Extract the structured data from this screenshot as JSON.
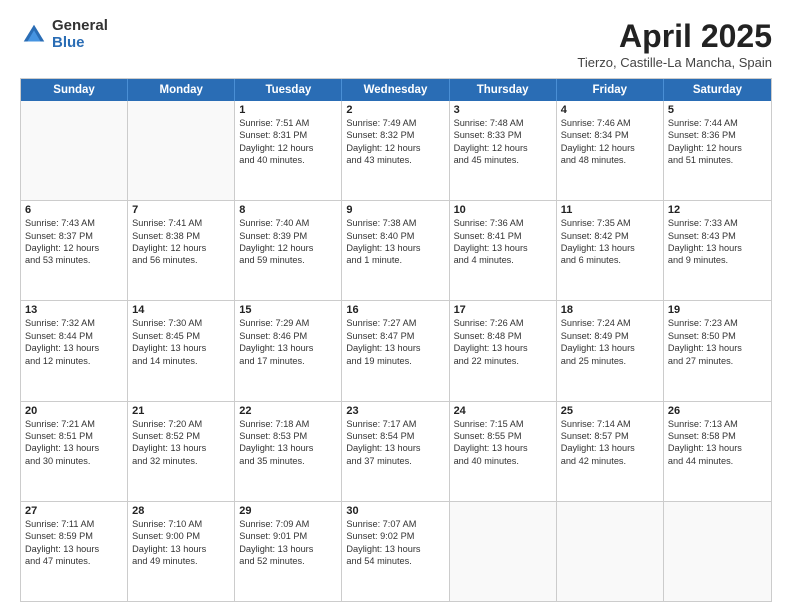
{
  "logo": {
    "general": "General",
    "blue": "Blue"
  },
  "title": {
    "month": "April 2025",
    "location": "Tierzo, Castille-La Mancha, Spain"
  },
  "header_days": [
    "Sunday",
    "Monday",
    "Tuesday",
    "Wednesday",
    "Thursday",
    "Friday",
    "Saturday"
  ],
  "rows": [
    [
      {
        "day": "",
        "lines": []
      },
      {
        "day": "",
        "lines": []
      },
      {
        "day": "1",
        "lines": [
          "Sunrise: 7:51 AM",
          "Sunset: 8:31 PM",
          "Daylight: 12 hours",
          "and 40 minutes."
        ]
      },
      {
        "day": "2",
        "lines": [
          "Sunrise: 7:49 AM",
          "Sunset: 8:32 PM",
          "Daylight: 12 hours",
          "and 43 minutes."
        ]
      },
      {
        "day": "3",
        "lines": [
          "Sunrise: 7:48 AM",
          "Sunset: 8:33 PM",
          "Daylight: 12 hours",
          "and 45 minutes."
        ]
      },
      {
        "day": "4",
        "lines": [
          "Sunrise: 7:46 AM",
          "Sunset: 8:34 PM",
          "Daylight: 12 hours",
          "and 48 minutes."
        ]
      },
      {
        "day": "5",
        "lines": [
          "Sunrise: 7:44 AM",
          "Sunset: 8:36 PM",
          "Daylight: 12 hours",
          "and 51 minutes."
        ]
      }
    ],
    [
      {
        "day": "6",
        "lines": [
          "Sunrise: 7:43 AM",
          "Sunset: 8:37 PM",
          "Daylight: 12 hours",
          "and 53 minutes."
        ]
      },
      {
        "day": "7",
        "lines": [
          "Sunrise: 7:41 AM",
          "Sunset: 8:38 PM",
          "Daylight: 12 hours",
          "and 56 minutes."
        ]
      },
      {
        "day": "8",
        "lines": [
          "Sunrise: 7:40 AM",
          "Sunset: 8:39 PM",
          "Daylight: 12 hours",
          "and 59 minutes."
        ]
      },
      {
        "day": "9",
        "lines": [
          "Sunrise: 7:38 AM",
          "Sunset: 8:40 PM",
          "Daylight: 13 hours",
          "and 1 minute."
        ]
      },
      {
        "day": "10",
        "lines": [
          "Sunrise: 7:36 AM",
          "Sunset: 8:41 PM",
          "Daylight: 13 hours",
          "and 4 minutes."
        ]
      },
      {
        "day": "11",
        "lines": [
          "Sunrise: 7:35 AM",
          "Sunset: 8:42 PM",
          "Daylight: 13 hours",
          "and 6 minutes."
        ]
      },
      {
        "day": "12",
        "lines": [
          "Sunrise: 7:33 AM",
          "Sunset: 8:43 PM",
          "Daylight: 13 hours",
          "and 9 minutes."
        ]
      }
    ],
    [
      {
        "day": "13",
        "lines": [
          "Sunrise: 7:32 AM",
          "Sunset: 8:44 PM",
          "Daylight: 13 hours",
          "and 12 minutes."
        ]
      },
      {
        "day": "14",
        "lines": [
          "Sunrise: 7:30 AM",
          "Sunset: 8:45 PM",
          "Daylight: 13 hours",
          "and 14 minutes."
        ]
      },
      {
        "day": "15",
        "lines": [
          "Sunrise: 7:29 AM",
          "Sunset: 8:46 PM",
          "Daylight: 13 hours",
          "and 17 minutes."
        ]
      },
      {
        "day": "16",
        "lines": [
          "Sunrise: 7:27 AM",
          "Sunset: 8:47 PM",
          "Daylight: 13 hours",
          "and 19 minutes."
        ]
      },
      {
        "day": "17",
        "lines": [
          "Sunrise: 7:26 AM",
          "Sunset: 8:48 PM",
          "Daylight: 13 hours",
          "and 22 minutes."
        ]
      },
      {
        "day": "18",
        "lines": [
          "Sunrise: 7:24 AM",
          "Sunset: 8:49 PM",
          "Daylight: 13 hours",
          "and 25 minutes."
        ]
      },
      {
        "day": "19",
        "lines": [
          "Sunrise: 7:23 AM",
          "Sunset: 8:50 PM",
          "Daylight: 13 hours",
          "and 27 minutes."
        ]
      }
    ],
    [
      {
        "day": "20",
        "lines": [
          "Sunrise: 7:21 AM",
          "Sunset: 8:51 PM",
          "Daylight: 13 hours",
          "and 30 minutes."
        ]
      },
      {
        "day": "21",
        "lines": [
          "Sunrise: 7:20 AM",
          "Sunset: 8:52 PM",
          "Daylight: 13 hours",
          "and 32 minutes."
        ]
      },
      {
        "day": "22",
        "lines": [
          "Sunrise: 7:18 AM",
          "Sunset: 8:53 PM",
          "Daylight: 13 hours",
          "and 35 minutes."
        ]
      },
      {
        "day": "23",
        "lines": [
          "Sunrise: 7:17 AM",
          "Sunset: 8:54 PM",
          "Daylight: 13 hours",
          "and 37 minutes."
        ]
      },
      {
        "day": "24",
        "lines": [
          "Sunrise: 7:15 AM",
          "Sunset: 8:55 PM",
          "Daylight: 13 hours",
          "and 40 minutes."
        ]
      },
      {
        "day": "25",
        "lines": [
          "Sunrise: 7:14 AM",
          "Sunset: 8:57 PM",
          "Daylight: 13 hours",
          "and 42 minutes."
        ]
      },
      {
        "day": "26",
        "lines": [
          "Sunrise: 7:13 AM",
          "Sunset: 8:58 PM",
          "Daylight: 13 hours",
          "and 44 minutes."
        ]
      }
    ],
    [
      {
        "day": "27",
        "lines": [
          "Sunrise: 7:11 AM",
          "Sunset: 8:59 PM",
          "Daylight: 13 hours",
          "and 47 minutes."
        ]
      },
      {
        "day": "28",
        "lines": [
          "Sunrise: 7:10 AM",
          "Sunset: 9:00 PM",
          "Daylight: 13 hours",
          "and 49 minutes."
        ]
      },
      {
        "day": "29",
        "lines": [
          "Sunrise: 7:09 AM",
          "Sunset: 9:01 PM",
          "Daylight: 13 hours",
          "and 52 minutes."
        ]
      },
      {
        "day": "30",
        "lines": [
          "Sunrise: 7:07 AM",
          "Sunset: 9:02 PM",
          "Daylight: 13 hours",
          "and 54 minutes."
        ]
      },
      {
        "day": "",
        "lines": []
      },
      {
        "day": "",
        "lines": []
      },
      {
        "day": "",
        "lines": []
      }
    ]
  ]
}
